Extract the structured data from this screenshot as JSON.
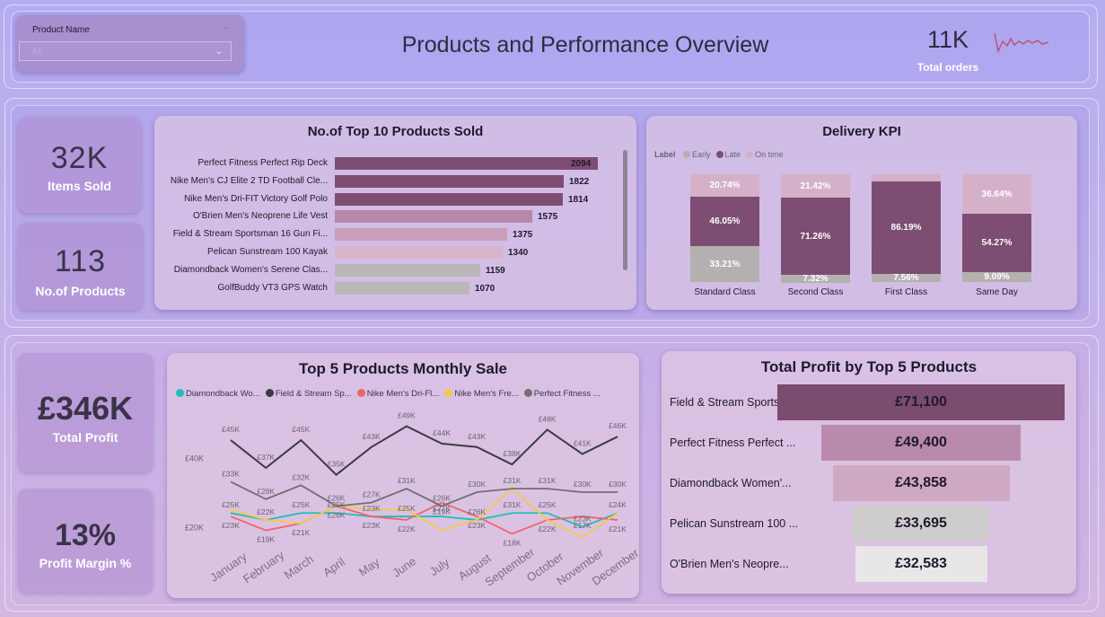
{
  "header": {
    "title": "Products and Performance Overview",
    "slicer_label": "Product Name",
    "slicer_value": "All",
    "orders_value": "11K",
    "orders_label": "Total orders"
  },
  "kpis": {
    "items_sold": {
      "value": "32K",
      "label": "Items Sold"
    },
    "products": {
      "value": "113",
      "label": "No.of Products"
    },
    "profit": {
      "value": "£346K",
      "label": "Total Profit"
    },
    "margin": {
      "value": "13%",
      "label": "Profit Margin %"
    }
  },
  "top10": {
    "title": "No.of Top 10 Products Sold",
    "items": [
      {
        "label": "Perfect Fitness Perfect Rip Deck",
        "value": "2094",
        "color": "#7e4d72"
      },
      {
        "label": "Nike Men's CJ Elite 2 TD Football Cle...",
        "value": "1822",
        "color": "#7e4d72"
      },
      {
        "label": "Nike Men's Dri-FIT Victory Golf Polo",
        "value": "1814",
        "color": "#7e4d72"
      },
      {
        "label": "O'Brien Men's Neoprene Life Vest",
        "value": "1575",
        "color": "#b987ab"
      },
      {
        "label": "Field & Stream Sportsman 16 Gun Fi...",
        "value": "1375",
        "color": "#c89fbb"
      },
      {
        "label": "Pelican Sunstream 100 Kayak",
        "value": "1340",
        "color": "#d9b3ca"
      },
      {
        "label": "Diamondback Women's Serene Clas...",
        "value": "1159",
        "color": "#b9b7b8"
      },
      {
        "label": "GolfBuddy VT3 GPS Watch",
        "value": "1070",
        "color": "#b9b7b8"
      }
    ]
  },
  "delivery": {
    "title": "Delivery KPI",
    "legend_title": "Label",
    "legend": [
      {
        "name": "Early",
        "color": "#b4b0b0"
      },
      {
        "name": "Late",
        "color": "#7d4d73"
      },
      {
        "name": "On time",
        "color": "#d5b1c9"
      }
    ],
    "bars": [
      {
        "name": "Standard Class",
        "on_time": "20.74%",
        "late": "46.05%",
        "early": "33.21%",
        "on_time_v": 20.74,
        "late_v": 46.05,
        "early_v": 33.21
      },
      {
        "name": "Second Class",
        "on_time": "21.42%",
        "late": "71.26%",
        "early": "7.32%",
        "on_time_v": 21.42,
        "late_v": 71.26,
        "early_v": 7.32
      },
      {
        "name": "First Class",
        "on_time": "",
        "late": "86.19%",
        "early": "7.56%",
        "on_time_v": 6.25,
        "late_v": 86.19,
        "early_v": 7.56
      },
      {
        "name": "Same Day",
        "on_time": "36.64%",
        "late": "54.27%",
        "early": "9.09%",
        "on_time_v": 36.64,
        "late_v": 54.27,
        "early_v": 9.09
      }
    ]
  },
  "chart_data": {
    "type": "line",
    "title": "Top 5 Products Monthly Sale",
    "x": [
      "January",
      "February",
      "March",
      "April",
      "May",
      "June",
      "July",
      "August",
      "September",
      "October",
      "November",
      "December"
    ],
    "yticks": [
      "£40K",
      "£20K"
    ],
    "ylim": [
      15000,
      52000
    ],
    "series": [
      {
        "name": "Diamondback Wo...",
        "color": "#1ebeb4",
        "values": [
          24000,
          22000,
          24000,
          24000,
          23000,
          23000,
          23000,
          22000,
          24000,
          24000,
          20000,
          24000
        ]
      },
      {
        "name": "Field & Stream Sp...",
        "color": "#3b3a44",
        "values": [
          45000,
          37000,
          45000,
          35000,
          43000,
          49000,
          44000,
          43000,
          38000,
          48000,
          41000,
          46000
        ]
      },
      {
        "name": "Nike Men's Dri-Fl...",
        "color": "#f0646c",
        "values": [
          23000,
          19000,
          21000,
          26000,
          23000,
          22000,
          27000,
          23000,
          18000,
          22000,
          23000,
          22000
        ]
      },
      {
        "name": "Nike Men's Fre...",
        "color": "#f3c94a",
        "values": [
          25000,
          22000,
          21000,
          26000,
          25000,
          25000,
          19000,
          22000,
          31000,
          22000,
          17000,
          24000
        ]
      },
      {
        "name": "Perfect Fitness ...",
        "color": "#707070",
        "values": [
          33000,
          28000,
          32000,
          26000,
          27000,
          31000,
          26000,
          30000,
          31000,
          31000,
          30000,
          30000
        ]
      }
    ],
    "point_labels": [
      [
        "£45K",
        "£37K",
        "£45K",
        "£35K",
        "£43K",
        "£49K",
        "£44K",
        "£43K",
        "£38K",
        "£48K",
        "£41K",
        "£46K"
      ],
      [
        "£33K",
        "£28K",
        "£32K",
        "£26K",
        "£27K",
        "£31K",
        "£26K",
        "£30K",
        "£31K",
        "£31K",
        "£30K",
        "£30K"
      ],
      [
        "£25K",
        "£22K",
        "£25K",
        "£25K",
        "£23K",
        "£25K",
        "£27K",
        "£26K",
        "£31K",
        "£25K",
        "£23K",
        "£24K"
      ],
      [
        "£23K",
        "£19K",
        "£21K",
        "£26K",
        "£23K",
        "£22K",
        "£19K",
        "£23K",
        "£18K",
        "£22K",
        "£17K",
        "£21K"
      ]
    ]
  },
  "profit": {
    "title": "Total Profit by Top 5 Products",
    "items": [
      {
        "label": "Field & Stream Sports...",
        "value": "£71,100",
        "amount": 71100,
        "color": "#7b4b70"
      },
      {
        "label": "Perfect Fitness Perfect ...",
        "value": "£49,400",
        "amount": 49400,
        "color": "#b98aab"
      },
      {
        "label": "Diamondback Women'...",
        "value": "£43,858",
        "amount": 43858,
        "color": "#cfa8c2"
      },
      {
        "label": "Pelican Sunstream 100 ...",
        "value": "£33,695",
        "amount": 33695,
        "color": "#cfcccd"
      },
      {
        "label": "O'Brien Men's Neopre...",
        "value": "£32,583",
        "amount": 32583,
        "color": "#e8e6e7"
      }
    ]
  }
}
